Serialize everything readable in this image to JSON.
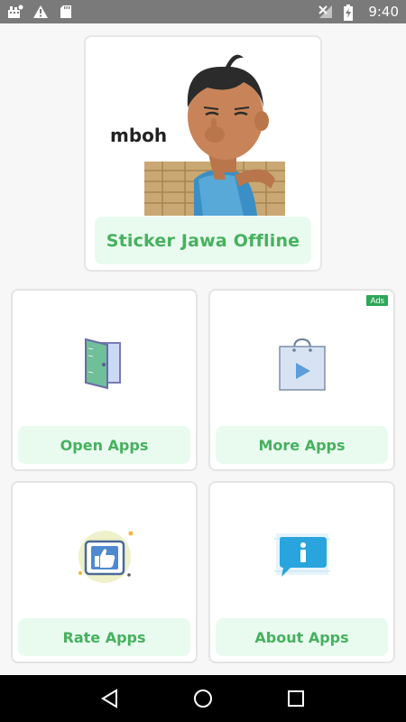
{
  "status_bar": {
    "time": "9:40",
    "left_icons": [
      "notification-icon",
      "warning-icon",
      "sd-card-icon"
    ],
    "right_icons": [
      "signal-off-icon",
      "battery-charging-icon"
    ]
  },
  "hero": {
    "title": "Sticker Jawa Offline",
    "sticker_caption": "mboh"
  },
  "tiles": [
    {
      "label": "Open Apps",
      "icon": "open-door-icon"
    },
    {
      "label": "More Apps",
      "icon": "play-store-bag-icon",
      "badge": "Ads"
    },
    {
      "label": "Rate Apps",
      "icon": "thumbs-up-icon"
    },
    {
      "label": "About Apps",
      "icon": "info-chat-icon"
    }
  ],
  "nav_bar": {
    "buttons": [
      "back-icon",
      "home-icon",
      "recents-icon"
    ]
  },
  "colors": {
    "accent_green": "#46b15e",
    "label_bg": "#e9fbef",
    "status_bar": "#7a7a7a"
  }
}
